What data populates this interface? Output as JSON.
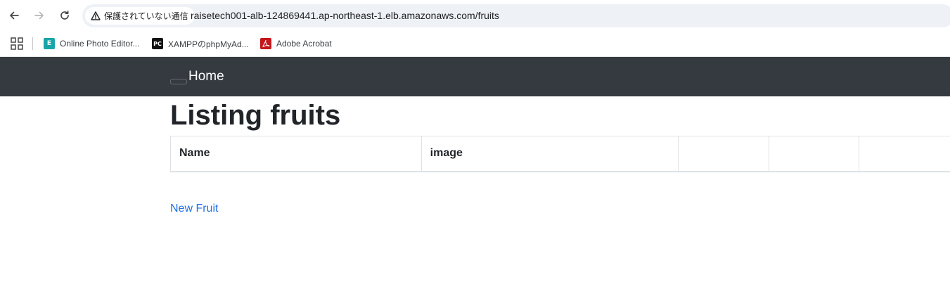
{
  "browser": {
    "security_label": "保護されていない通信",
    "url": "raisetech001-alb-124869441.ap-northeast-1.elb.amazonaws.com/fruits",
    "bookmarks": [
      {
        "label": "Online Photo Editor...",
        "icon": "photo-editor-icon"
      },
      {
        "label": "XAMPPのphpMyAd...",
        "icon": "phpstorm-pc-icon",
        "icon_text": "PC"
      },
      {
        "label": "Adobe Acrobat",
        "icon": "acrobat-icon"
      }
    ]
  },
  "navbar": {
    "home_label": "Home",
    "background": "#343a40"
  },
  "main": {
    "title": "Listing fruits",
    "table": {
      "columns": [
        "Name",
        "image",
        "",
        "",
        ""
      ],
      "rows": []
    },
    "new_link_label": "New Fruit",
    "link_color": "#1f72e6"
  }
}
